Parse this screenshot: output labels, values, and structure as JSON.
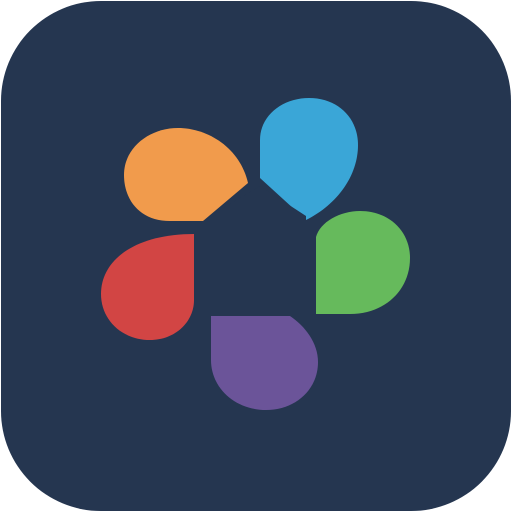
{
  "app_icon": {
    "label": "",
    "background_color": "#253650",
    "center_color": "#253650",
    "petals": [
      {
        "name": "orange",
        "color": "#F19B4C"
      },
      {
        "name": "blue",
        "color": "#3AA6D7"
      },
      {
        "name": "green",
        "color": "#66BA5C"
      },
      {
        "name": "purple",
        "color": "#6B5499"
      },
      {
        "name": "red",
        "color": "#D24544"
      }
    ]
  }
}
